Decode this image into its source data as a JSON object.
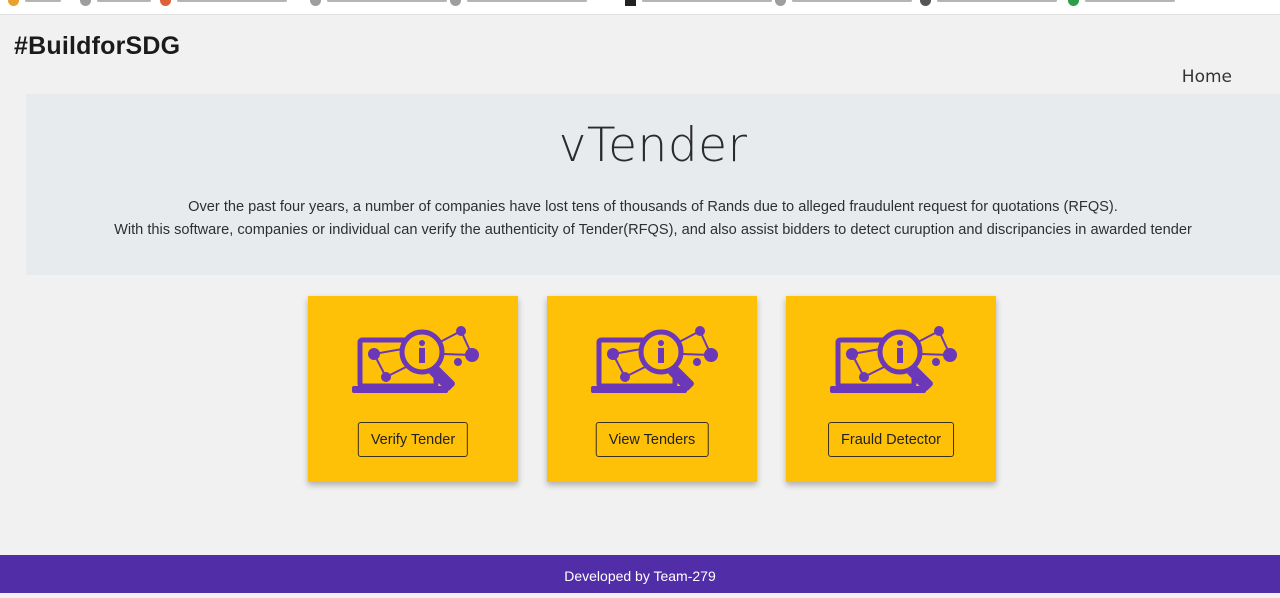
{
  "header": {
    "brand": "#BuildforSDG",
    "nav_home": "Home"
  },
  "hero": {
    "title": "vTender",
    "lead_line1": "Over the past four years, a number of companies have lost tens of thousands of Rands due to alleged fraudulent request for quotations (RFQS).",
    "lead_line2": "With this software, companies or individual can verify the authenticity of Tender(RFQS), and also assist bidders to detect curuption and discripancies in awarded tender"
  },
  "cards": [
    {
      "icon": "laptop-magnifier-icon",
      "button_label": "Verify Tender"
    },
    {
      "icon": "laptop-magnifier-icon",
      "button_label": "View Tenders"
    },
    {
      "icon": "laptop-magnifier-icon",
      "button_label": "Frauld Detector"
    }
  ],
  "footer": {
    "text": "Developed by Team-279"
  },
  "colors": {
    "card_background": "#ffc107",
    "icon_purple": "#6a38b8",
    "footer_background": "#512da8",
    "hero_background": "#e8ebee"
  }
}
